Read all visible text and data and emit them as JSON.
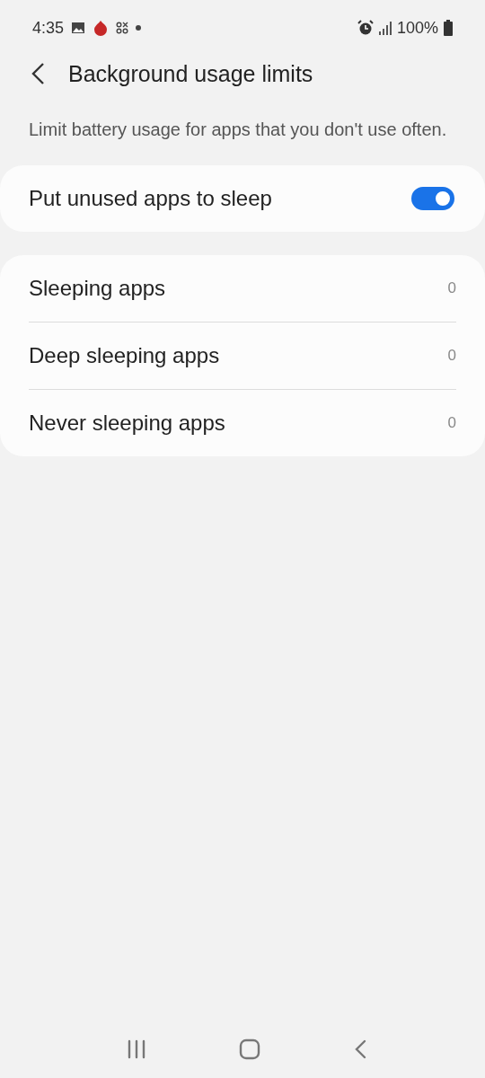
{
  "status_bar": {
    "time": "4:35",
    "battery": "100%"
  },
  "header": {
    "title": "Background usage limits"
  },
  "description": "Limit battery usage for apps that you don't use often.",
  "sleep_toggle": {
    "label": "Put unused apps to sleep",
    "on": true
  },
  "app_lists": [
    {
      "label": "Sleeping apps",
      "count": "0"
    },
    {
      "label": "Deep sleeping apps",
      "count": "0"
    },
    {
      "label": "Never sleeping apps",
      "count": "0"
    }
  ]
}
